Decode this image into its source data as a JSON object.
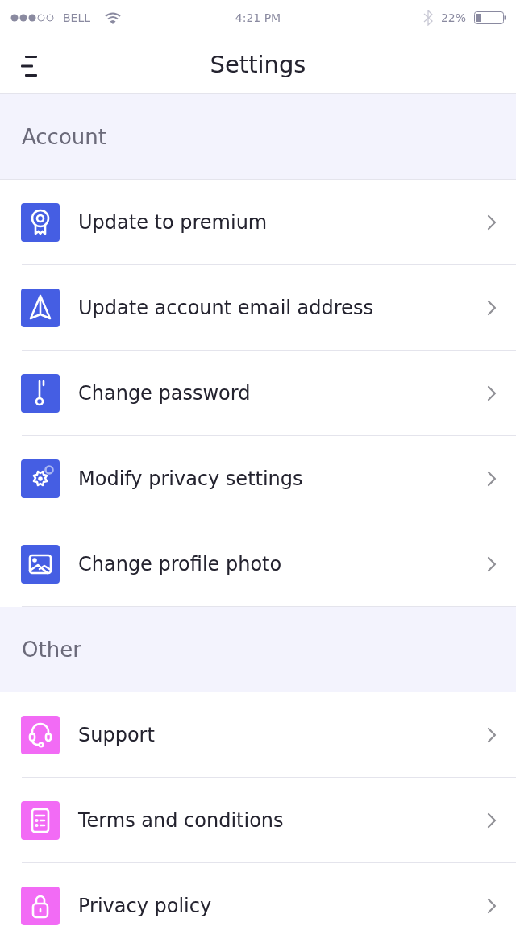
{
  "status_bar": {
    "carrier": "BELL",
    "time": "4:21 PM",
    "battery": "22%"
  },
  "header": {
    "title": "Settings"
  },
  "sections": [
    {
      "title": "Account",
      "color": "#455ee3",
      "items": [
        {
          "label": "Update to premium",
          "kind": "award"
        },
        {
          "label": "Update account email address",
          "kind": "send"
        },
        {
          "label": "Change password",
          "kind": "key"
        },
        {
          "label": "Modify privacy settings",
          "kind": "gear"
        },
        {
          "label": "Change profile photo",
          "kind": "image"
        }
      ]
    },
    {
      "title": "Other",
      "color": "#f26bf5",
      "items": [
        {
          "label": "Support",
          "kind": "headset"
        },
        {
          "label": "Terms and conditions",
          "kind": "document"
        },
        {
          "label": "Privacy policy",
          "kind": "lock"
        }
      ]
    }
  ]
}
